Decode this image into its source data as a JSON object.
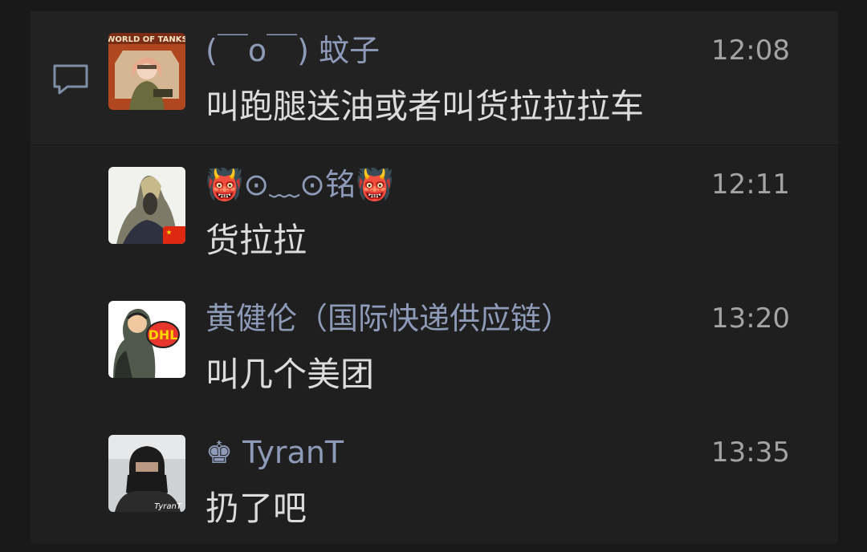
{
  "messages": [
    {
      "name": "(￣o￣) 蚊子",
      "time": "12:08",
      "text": "叫跑腿送油或者叫货拉拉拉车",
      "avatar_text": "WORLD OF TANKS"
    },
    {
      "name": "👹⊙﹏⊙铭👹",
      "time": "12:11",
      "text": "货拉拉"
    },
    {
      "name": "黄健伦（国际快递供应链）",
      "time": "13:20",
      "text": "叫几个美团",
      "avatar_text": "DHL"
    },
    {
      "name": "♚ TyranT",
      "time": "13:35",
      "text": "扔了吧",
      "avatar_text": "TyranT"
    }
  ],
  "icons": {
    "comment": "comment-bubble-icon",
    "flag": "china-flag-icon"
  },
  "colors": {
    "name": "#8d9ab8",
    "time": "#a3a3a3",
    "text": "#dcdcdc",
    "background": "#191919"
  }
}
